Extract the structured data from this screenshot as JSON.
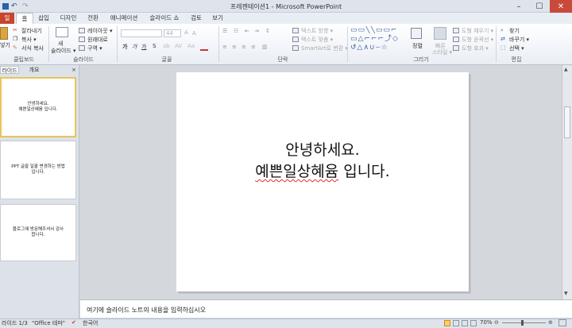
{
  "window": {
    "title": "프레젠테이션1 - Microsoft PowerPoint",
    "minimize": "–",
    "maximize": "☐",
    "close": "✕"
  },
  "qat": {
    "undo": "↶",
    "redo": "↷"
  },
  "tabs": [
    "일",
    "홈",
    "삽입",
    "디자인",
    "전환",
    "애니메이션",
    "슬라이드 쇼",
    "검토",
    "보기"
  ],
  "ribbon": {
    "clipboard": {
      "paste": "넣기",
      "cut": "잘라내기",
      "copy": "복사 ▾",
      "format": "서식 복사",
      "label": "클립보드"
    },
    "slides": {
      "new_slide": "새",
      "new_slide_2": "슬라이드 ▾",
      "layout": "레이아웃 ▾",
      "reset": "원래대로",
      "section": "구역 ▾",
      "label": "슬라이드"
    },
    "font": {
      "size": "44",
      "bold": "가",
      "italic": "가",
      "underline": "가",
      "strike": "S",
      "label": "글꼴"
    },
    "paragraph": {
      "text_dir": "텍스트 방향 ▾",
      "align_text": "텍스트 맞춤 ▾",
      "smartart": "SmartArt로 변환 ▾",
      "label": "단락"
    },
    "drawing": {
      "arrange": "정렬",
      "quick": "빠른",
      "quick2": "스타일 ▾",
      "fill": "도형 채우기 ▾",
      "outline": "도형 윤곽선 ▾",
      "effects": "도형 효과 ▾",
      "label": "그리기"
    },
    "editing": {
      "find": "찾기",
      "replace": "바꾸기 ▾",
      "select": "선택 ▾",
      "label": "편집"
    }
  },
  "panel": {
    "tab_slides": "라이드",
    "tab_outline": "개요",
    "close": "×",
    "thumbs": [
      {
        "line1": "안녕하세요.",
        "line2": "예쁜일상혜윰 입니다."
      },
      {
        "line1": "PPT 글꼴 일괄 변경하는 방법",
        "line2": "입니다."
      },
      {
        "line1": "블로그에 방문해주셔서 감사",
        "line2": "합니다."
      }
    ]
  },
  "slide": {
    "line1": "안녕하세요.",
    "line2a": "예쁜일상혜윰",
    "line2b": " 입니다."
  },
  "notes": {
    "placeholder": "여기에 슬라이드 노트의 내용을 입력하십시오"
  },
  "status": {
    "slide_count": "라이드 1/3",
    "theme": "\"Office 테마\"",
    "language": "한국어",
    "zoom": "70%"
  },
  "colors": {
    "file_tab": "#c8452e",
    "selected_thumb": "#e9c35b",
    "spell_underline": "#e03030"
  }
}
